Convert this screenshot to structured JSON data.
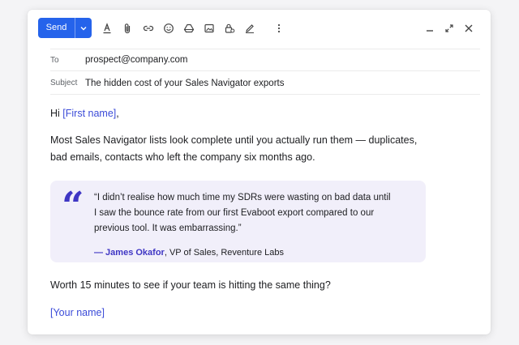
{
  "toolbar": {
    "send_label": "Send",
    "icons": [
      "text-format-icon",
      "attach-icon",
      "link-icon",
      "emoji-icon",
      "drive-icon",
      "image-icon",
      "confidential-lock-icon",
      "signature-pen-icon",
      "more-options-icon"
    ],
    "window_controls": [
      "minimize-icon",
      "expand-icon",
      "close-icon"
    ]
  },
  "fields": {
    "to_label": "To",
    "to_value": "prospect@company.com",
    "subject_label": "Subject",
    "subject_value": "The hidden cost of your Sales Navigator exports"
  },
  "message": {
    "greeting_prefix": "Hi ",
    "greeting_placeholder": "[First name]",
    "greeting_suffix": ",",
    "para1_line1": "Most Sales Navigator lists look complete until you actually run them — duplicates,",
    "para1_line2": "bad emails, contacts who left the company six months ago.",
    "quote_line1": "“I didn’t realise how much time my SDRs were wasting on bad data until",
    "quote_line2": "I saw the bounce rate from our first Evaboot export compared to our",
    "quote_line3": "previous tool. It was embarrassing.”",
    "quote_author": "— James Okafor",
    "quote_role": ", VP of Sales, Reventure Labs",
    "cta": "Worth 15 minutes to see if your team is hitting the same thing?",
    "signature_placeholder": "[Your name]"
  },
  "colors": {
    "send_button": "#2563eb",
    "placeholder_text": "#3b4bd8",
    "quote_background": "#f1effa",
    "quote_accent": "#3f36c4"
  }
}
